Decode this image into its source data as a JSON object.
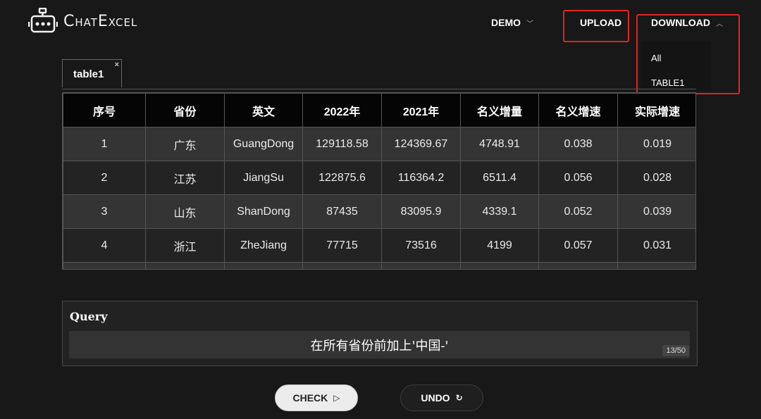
{
  "app": {
    "name": "ChatExcel",
    "logo_icon": "robot-icon"
  },
  "nav": {
    "demo": "DEMO",
    "upload": "UPLOAD",
    "download": "DOWNLOAD",
    "download_menu": [
      "All",
      "TABLE1"
    ]
  },
  "tabs": [
    {
      "label": "table1",
      "close": "×"
    }
  ],
  "table": {
    "headers": [
      "序号",
      "省份",
      "英文",
      "2022年",
      "2021年",
      "名义增量",
      "名义增速",
      "实际增速"
    ],
    "rows": [
      [
        "1",
        "广东",
        "GuangDong",
        "129118.58",
        "124369.67",
        "4748.91",
        "0.038",
        "0.019"
      ],
      [
        "2",
        "江苏",
        "JiangSu",
        "122875.6",
        "116364.2",
        "6511.4",
        "0.056",
        "0.028"
      ],
      [
        "3",
        "山东",
        "ShanDong",
        "87435",
        "83095.9",
        "4339.1",
        "0.052",
        "0.039"
      ],
      [
        "4",
        "浙江",
        "ZheJiang",
        "77715",
        "73516",
        "4199",
        "0.057",
        "0.031"
      ]
    ]
  },
  "query": {
    "title": "Query",
    "value": "在所有省份前加上'中国-'",
    "counter": "13/50"
  },
  "buttons": {
    "check": "CHECK",
    "check_icon": "▷",
    "undo": "UNDO",
    "undo_icon": "↻"
  },
  "colors": {
    "highlight": "#e02424",
    "background": "#181818"
  }
}
